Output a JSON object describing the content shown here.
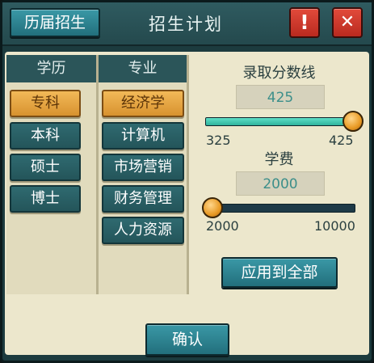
{
  "header": {
    "history_label": "历届招生",
    "title": "招生计划",
    "alert_icon": "!",
    "close_icon": "✕"
  },
  "degree": {
    "header": "学历",
    "items": [
      "专科",
      "本科",
      "硕士",
      "博士"
    ],
    "selected_index": 0
  },
  "major": {
    "header": "专业",
    "items": [
      "经济学",
      "计算机",
      "市场营销",
      "财务管理",
      "人力资源"
    ],
    "selected_index": 0
  },
  "score": {
    "label": "录取分数线",
    "value": "425",
    "min_label": "325",
    "max_label": "425",
    "min": 325,
    "max": 425,
    "current": 425
  },
  "fee": {
    "label": "学费",
    "value": "2000",
    "min_label": "2000",
    "max_label": "10000",
    "min": 2000,
    "max": 10000,
    "current": 2000
  },
  "apply_label": "应用到全部",
  "confirm_label": "确认"
}
